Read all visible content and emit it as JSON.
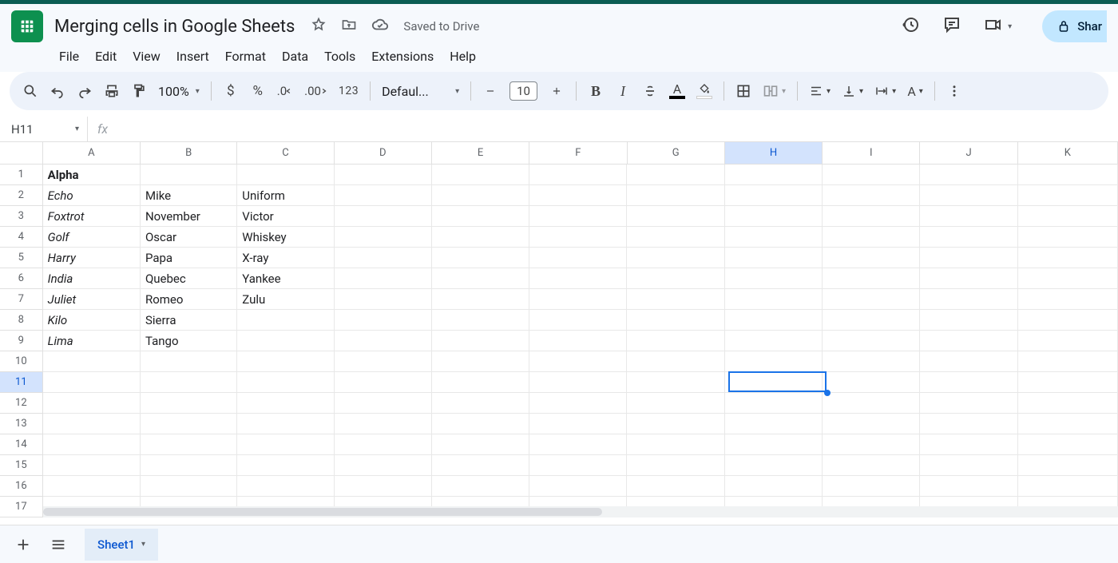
{
  "doc": {
    "title": "Merging cells in Google Sheets",
    "save_status": "Saved to Drive"
  },
  "menu": [
    "File",
    "Edit",
    "View",
    "Insert",
    "Format",
    "Data",
    "Tools",
    "Extensions",
    "Help"
  ],
  "toolbar": {
    "zoom": "100%",
    "font_name": "Defaul...",
    "font_size": "10",
    "fmt123": "123"
  },
  "share_label": "Shar",
  "namebox": "H11",
  "columns": [
    "A",
    "B",
    "C",
    "D",
    "E",
    "F",
    "G",
    "H",
    "I",
    "J",
    "K"
  ],
  "rows": [
    "1",
    "2",
    "3",
    "4",
    "5",
    "6",
    "7",
    "8",
    "9",
    "10",
    "11",
    "12",
    "13",
    "14",
    "15",
    "16",
    "17"
  ],
  "selected": {
    "col_index": 7,
    "row_index": 10
  },
  "cells": {
    "r1": {
      "A": "Alpha"
    },
    "r2": {
      "A": "Echo",
      "B": "Mike",
      "C": "Uniform"
    },
    "r3": {
      "A": "Foxtrot",
      "B": "November",
      "C": "Victor"
    },
    "r4": {
      "A": "Golf",
      "B": "Oscar",
      "C": "Whiskey"
    },
    "r5": {
      "A": "Harry",
      "B": "Papa",
      "C": "X-ray"
    },
    "r6": {
      "A": "India",
      "B": "Quebec",
      "C": "Yankee"
    },
    "r7": {
      "A": "Juliet",
      "B": "Romeo",
      "C": "Zulu"
    },
    "r8": {
      "A": "Kilo",
      "B": "Sierra"
    },
    "r9": {
      "A": "Lima",
      "B": "Tango"
    }
  },
  "styles": {
    "bold": [
      "r1.A"
    ],
    "italic": [
      "r2.A",
      "r3.A",
      "r4.A",
      "r5.A",
      "r6.A",
      "r7.A",
      "r8.A",
      "r9.A"
    ]
  },
  "sheet_tab": "Sheet1"
}
